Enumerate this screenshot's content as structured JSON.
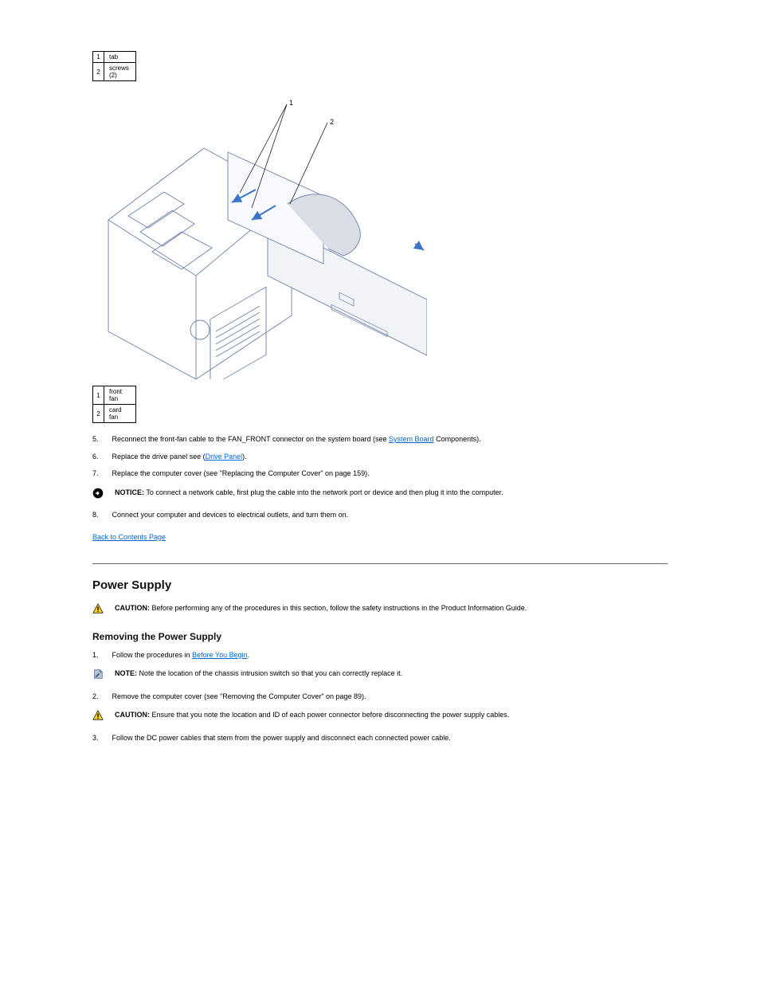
{
  "table1": {
    "r1c1": "1",
    "r1c2": "tab",
    "r2c1": "2",
    "r2c2": "screws (2)"
  },
  "figure": {
    "label1": "1",
    "label2": "2"
  },
  "table2": {
    "r1c1": "1",
    "r1c2": "front fan",
    "r2c1": "2",
    "r2c2": "card fan"
  },
  "step5": {
    "prefix": "5.",
    "text_a": "Reconnect the front-fan cable to the FAN_FRONT connector on the system board (see ",
    "link": "System Board",
    "text_b": " Components)."
  },
  "step6": {
    "prefix": "6.",
    "text_a": "Replace the drive panel see (",
    "link": "Drive Panel",
    "text_b": ")."
  },
  "step7": {
    "prefix": "7.",
    "text": "Replace the computer cover (see \"Replacing the Computer Cover\" on page 159)."
  },
  "notice1": {
    "label": "NOTICE:",
    "text": " To connect a network cable, first plug the cable into the network port or device and then plug it into the computer."
  },
  "step8": {
    "prefix": "8.",
    "text": "Connect your computer and devices to electrical outlets, and turn them on."
  },
  "back": {
    "text_a": "",
    "link": "Back to Contents Page"
  },
  "section_title": "Power Supply",
  "caution1": {
    "label": "CAUTION:",
    "text": " Before performing any of the procedures in this section, follow the safety instructions in the Product Information Guide."
  },
  "sub_title": "Removing the Power Supply",
  "sub_step1": {
    "prefix": "1.",
    "text_a": "Follow the procedures in ",
    "link": "Before You Begin",
    "text_b": "."
  },
  "note": {
    "label": "NOTE:",
    "text": " Note the location of the chassis intrusion switch so that you can correctly replace it."
  },
  "sub_step2": {
    "prefix": "2.",
    "text": "Remove the computer cover (see \"Removing the Computer Cover\" on page 89)."
  },
  "caution2": {
    "label": "CAUTION:",
    "text": " Ensure that you note the location and ID of each power connector before disconnecting the power supply cables."
  },
  "sub_step3": {
    "prefix": "3.",
    "text": "Follow the DC power cables that stem from the power supply and disconnect each connected power cable."
  }
}
